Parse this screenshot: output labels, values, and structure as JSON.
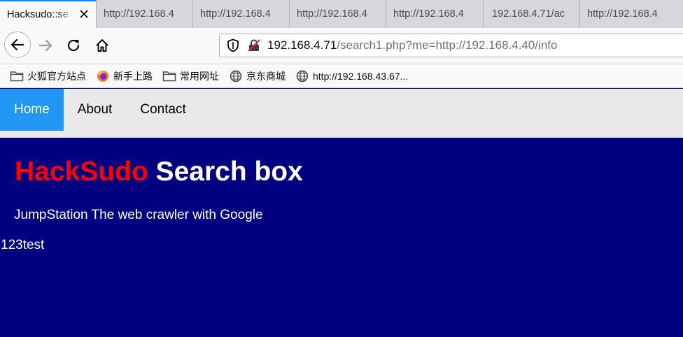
{
  "browser": {
    "tabs": [
      {
        "label": "Hacksudo::se",
        "active": true
      },
      {
        "label": "http://192.168.4",
        "active": false
      },
      {
        "label": "http://192.168.4",
        "active": false
      },
      {
        "label": "http://192.168.4",
        "active": false
      },
      {
        "label": "http://192.168.4",
        "active": false
      },
      {
        "label": "192.168.4.71/ac",
        "active": false
      },
      {
        "label": "http://192.168.4",
        "active": false
      }
    ],
    "url": {
      "host": "192.168.4.71",
      "path": "/search1.php?me=http://192.168.4.40/info"
    },
    "bookmarks": [
      {
        "label": "火狐官方站点",
        "icon": "folder-icon"
      },
      {
        "label": "新手上路",
        "icon": "firefox-icon"
      },
      {
        "label": "常用网址",
        "icon": "folder-icon"
      },
      {
        "label": "京东商城",
        "icon": "globe-icon"
      },
      {
        "label": "http://192.168.43.67...",
        "icon": "globe-icon"
      }
    ]
  },
  "page": {
    "nav": [
      {
        "label": "Home",
        "active": true
      },
      {
        "label": "About",
        "active": false
      },
      {
        "label": "Contact",
        "active": false
      }
    ],
    "heading_brand": "HackSudo",
    "heading_rest": " Search box",
    "tagline": "JumpStation The web crawler with Google",
    "output": "123test"
  },
  "colors": {
    "page_bg": "#000080",
    "brand_red": "#ff0000",
    "nav_active": "#2196f3",
    "nav_bg": "#e9e9e9"
  }
}
